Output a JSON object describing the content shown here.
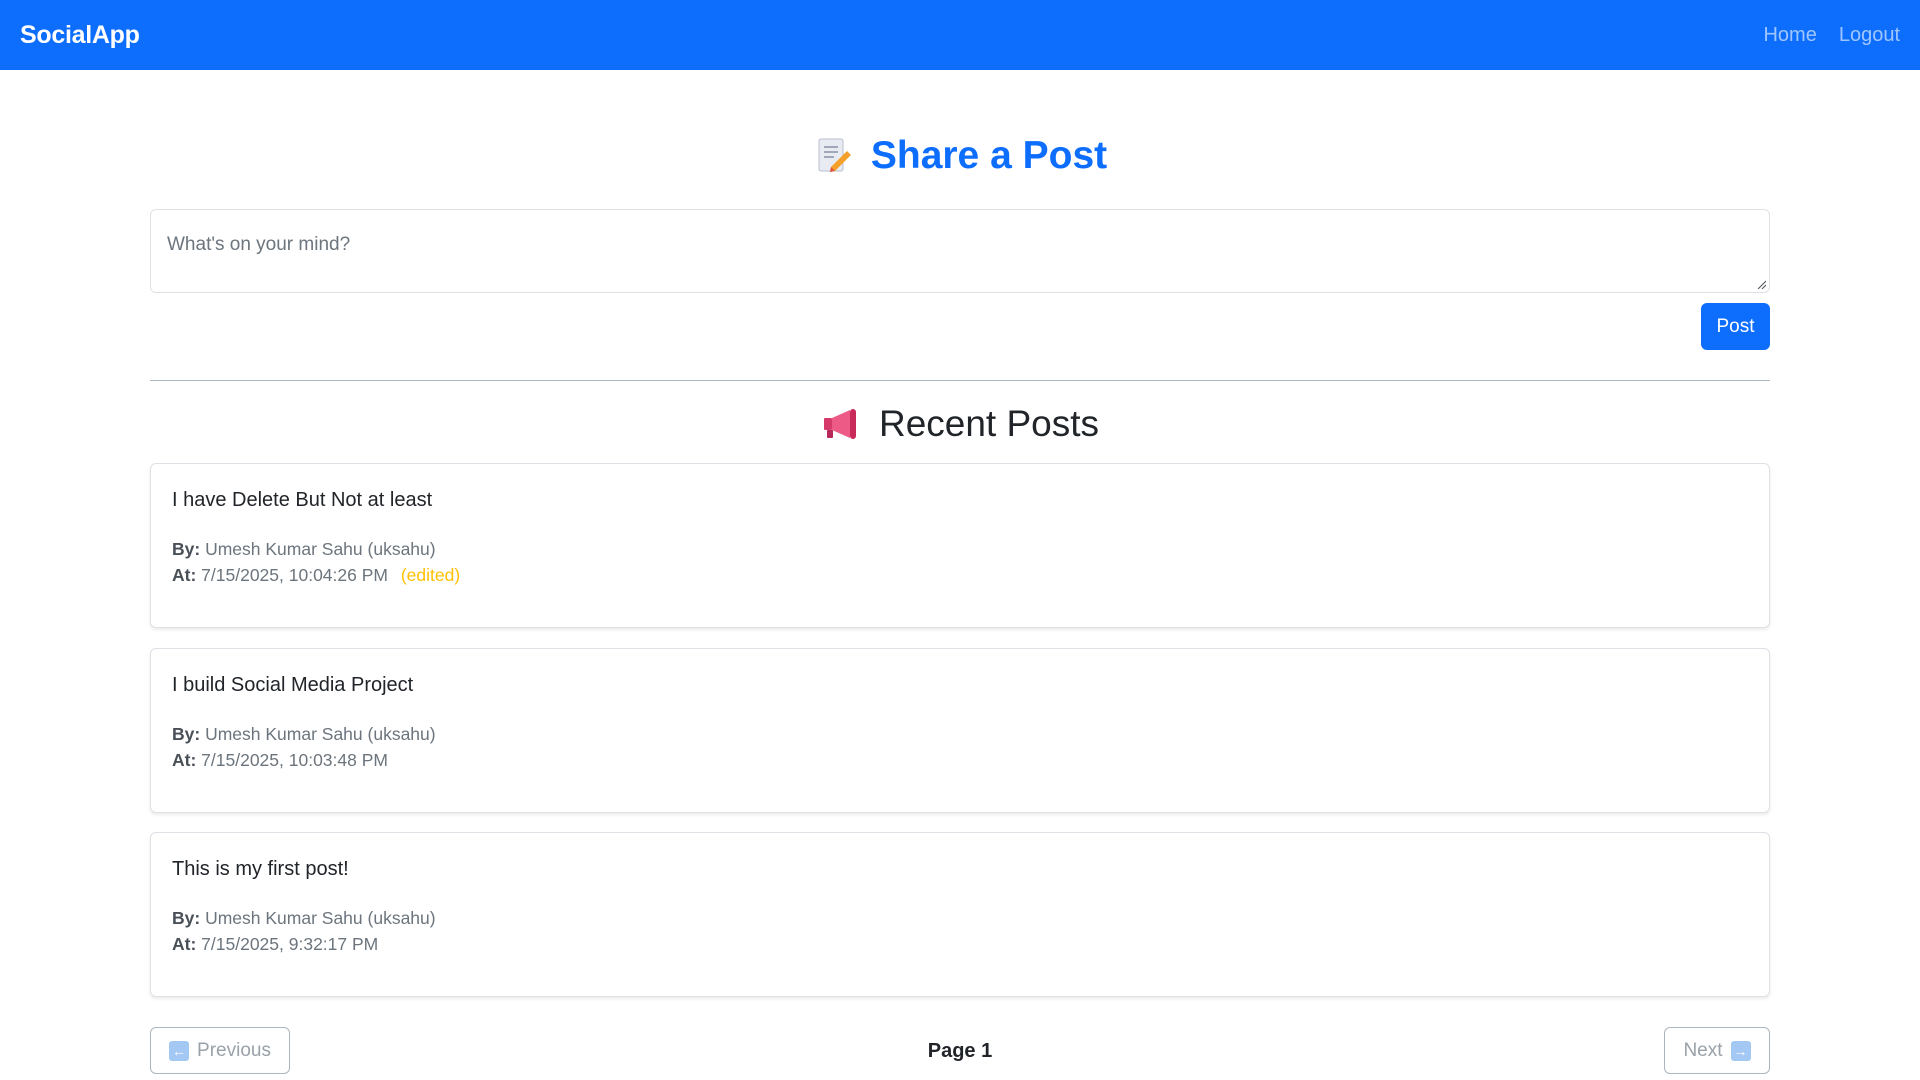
{
  "navbar": {
    "brand": "SocialApp",
    "links": [
      "Home",
      "Logout"
    ]
  },
  "share": {
    "title": "Share a Post",
    "icon": "memo-icon",
    "placeholder": "What's on your mind?",
    "post_button": "Post"
  },
  "recent": {
    "title": "Recent Posts",
    "icon": "megaphone-icon"
  },
  "labels": {
    "by": "By:",
    "at": "At:",
    "edited": "(edited)"
  },
  "posts": [
    {
      "content": "I have Delete But Not at least",
      "author": "Umesh Kumar Sahu (uksahu)",
      "timestamp": "7/15/2025, 10:04:26 PM",
      "edited": true
    },
    {
      "content": "I build Social Media Project",
      "author": "Umesh Kumar Sahu (uksahu)",
      "timestamp": "7/15/2025, 10:03:48 PM",
      "edited": false
    },
    {
      "content": "This is my first post!",
      "author": "Umesh Kumar Sahu (uksahu)",
      "timestamp": "7/15/2025, 9:32:17 PM",
      "edited": false
    }
  ],
  "pagination": {
    "previous": "Previous",
    "next": "Next",
    "page_label": "Page 1"
  },
  "colors": {
    "primary": "#0d6efd",
    "edited": "#ffc107"
  }
}
